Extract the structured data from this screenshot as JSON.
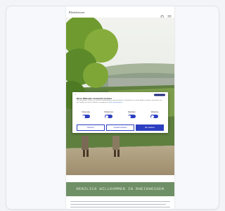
{
  "header": {
    "logo_text": "Rheinhessen",
    "icons": [
      "search-icon",
      "menu-icon"
    ]
  },
  "banner": {
    "title": "Herzlich willkommen in Rheinhessen"
  },
  "cookie": {
    "title": "Diese Webseite verwendet Cookies",
    "text": "Wir verwenden Cookies, um Inhalte und Anzeigen zu personalisieren, Funktionen für soziale Medien anbieten zu können und die Zugriffe auf unsere Website zu analysieren.",
    "link": "Mehr Informationen",
    "toggles": [
      {
        "label": "Notwendig"
      },
      {
        "label": "Präferenzen"
      },
      {
        "label": "Statistiken"
      },
      {
        "label": "Marketing"
      }
    ],
    "buttons": {
      "deny": "Ablehnen",
      "selection": "Auswahl erlauben",
      "accept_all": "Alle zulassen"
    }
  },
  "colors": {
    "banner": "#6f8f66",
    "cookie_accent": "#2d3fc1"
  }
}
